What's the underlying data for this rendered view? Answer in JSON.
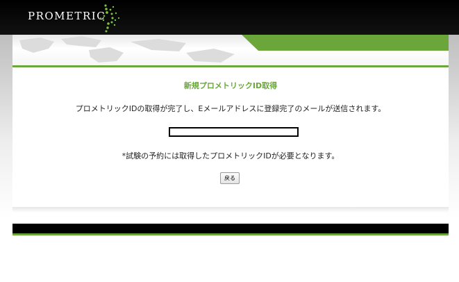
{
  "header": {
    "logo_text": "PROMETRIC"
  },
  "main": {
    "title": "新規プロメトリックID取得",
    "message": "プロメトリックIDの取得が完了し、Eメールアドレスに登録完了のメールが送信されます。",
    "id_value": "",
    "note": "*試験の予約には取得したプロメトリックIDが必要となります。",
    "back_label": "戻る"
  },
  "colors": {
    "brand_green": "#6aa63a",
    "header_black": "#000000"
  },
  "icons": {
    "logo_mark": "starburst-icon"
  }
}
